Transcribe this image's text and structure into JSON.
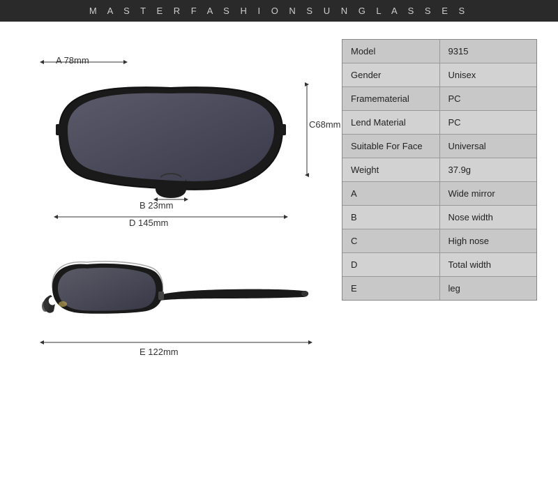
{
  "header": {
    "title": "M A S T E R F A S H I O N S U N G L A S S E S"
  },
  "dimensions": {
    "a": "A 78mm",
    "b": "B 23mm",
    "c": "C68mm",
    "d": "D 145mm",
    "e": "E 122mm"
  },
  "specs": [
    {
      "label": "Model",
      "value": "9315"
    },
    {
      "label": "Gender",
      "value": "Unisex"
    },
    {
      "label": "Framematerial",
      "value": "PC"
    },
    {
      "label": "Lend Material",
      "value": "PC"
    },
    {
      "label": "Suitable For Face",
      "value": "Universal"
    },
    {
      "label": "Weight",
      "value": "37.9g"
    },
    {
      "label": "A",
      "value": "Wide mirror"
    },
    {
      "label": "B",
      "value": "Nose width"
    },
    {
      "label": "C",
      "value": "High nose"
    },
    {
      "label": "D",
      "value": "Total width"
    },
    {
      "label": "E",
      "value": "leg"
    }
  ]
}
